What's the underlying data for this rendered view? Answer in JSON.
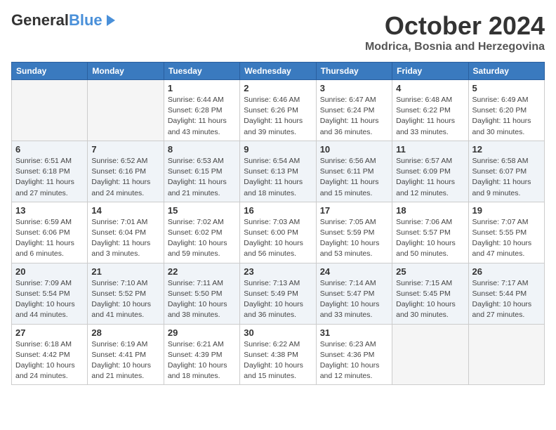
{
  "header": {
    "logo_general": "General",
    "logo_blue": "Blue",
    "month": "October 2024",
    "location": "Modrica, Bosnia and Herzegovina"
  },
  "days_of_week": [
    "Sunday",
    "Monday",
    "Tuesday",
    "Wednesday",
    "Thursday",
    "Friday",
    "Saturday"
  ],
  "weeks": [
    [
      {
        "day": "",
        "sunrise": "",
        "sunset": "",
        "daylight": ""
      },
      {
        "day": "",
        "sunrise": "",
        "sunset": "",
        "daylight": ""
      },
      {
        "day": "1",
        "sunrise": "Sunrise: 6:44 AM",
        "sunset": "Sunset: 6:28 PM",
        "daylight": "Daylight: 11 hours and 43 minutes."
      },
      {
        "day": "2",
        "sunrise": "Sunrise: 6:46 AM",
        "sunset": "Sunset: 6:26 PM",
        "daylight": "Daylight: 11 hours and 39 minutes."
      },
      {
        "day": "3",
        "sunrise": "Sunrise: 6:47 AM",
        "sunset": "Sunset: 6:24 PM",
        "daylight": "Daylight: 11 hours and 36 minutes."
      },
      {
        "day": "4",
        "sunrise": "Sunrise: 6:48 AM",
        "sunset": "Sunset: 6:22 PM",
        "daylight": "Daylight: 11 hours and 33 minutes."
      },
      {
        "day": "5",
        "sunrise": "Sunrise: 6:49 AM",
        "sunset": "Sunset: 6:20 PM",
        "daylight": "Daylight: 11 hours and 30 minutes."
      }
    ],
    [
      {
        "day": "6",
        "sunrise": "Sunrise: 6:51 AM",
        "sunset": "Sunset: 6:18 PM",
        "daylight": "Daylight: 11 hours and 27 minutes."
      },
      {
        "day": "7",
        "sunrise": "Sunrise: 6:52 AM",
        "sunset": "Sunset: 6:16 PM",
        "daylight": "Daylight: 11 hours and 24 minutes."
      },
      {
        "day": "8",
        "sunrise": "Sunrise: 6:53 AM",
        "sunset": "Sunset: 6:15 PM",
        "daylight": "Daylight: 11 hours and 21 minutes."
      },
      {
        "day": "9",
        "sunrise": "Sunrise: 6:54 AM",
        "sunset": "Sunset: 6:13 PM",
        "daylight": "Daylight: 11 hours and 18 minutes."
      },
      {
        "day": "10",
        "sunrise": "Sunrise: 6:56 AM",
        "sunset": "Sunset: 6:11 PM",
        "daylight": "Daylight: 11 hours and 15 minutes."
      },
      {
        "day": "11",
        "sunrise": "Sunrise: 6:57 AM",
        "sunset": "Sunset: 6:09 PM",
        "daylight": "Daylight: 11 hours and 12 minutes."
      },
      {
        "day": "12",
        "sunrise": "Sunrise: 6:58 AM",
        "sunset": "Sunset: 6:07 PM",
        "daylight": "Daylight: 11 hours and 9 minutes."
      }
    ],
    [
      {
        "day": "13",
        "sunrise": "Sunrise: 6:59 AM",
        "sunset": "Sunset: 6:06 PM",
        "daylight": "Daylight: 11 hours and 6 minutes."
      },
      {
        "day": "14",
        "sunrise": "Sunrise: 7:01 AM",
        "sunset": "Sunset: 6:04 PM",
        "daylight": "Daylight: 11 hours and 3 minutes."
      },
      {
        "day": "15",
        "sunrise": "Sunrise: 7:02 AM",
        "sunset": "Sunset: 6:02 PM",
        "daylight": "Daylight: 10 hours and 59 minutes."
      },
      {
        "day": "16",
        "sunrise": "Sunrise: 7:03 AM",
        "sunset": "Sunset: 6:00 PM",
        "daylight": "Daylight: 10 hours and 56 minutes."
      },
      {
        "day": "17",
        "sunrise": "Sunrise: 7:05 AM",
        "sunset": "Sunset: 5:59 PM",
        "daylight": "Daylight: 10 hours and 53 minutes."
      },
      {
        "day": "18",
        "sunrise": "Sunrise: 7:06 AM",
        "sunset": "Sunset: 5:57 PM",
        "daylight": "Daylight: 10 hours and 50 minutes."
      },
      {
        "day": "19",
        "sunrise": "Sunrise: 7:07 AM",
        "sunset": "Sunset: 5:55 PM",
        "daylight": "Daylight: 10 hours and 47 minutes."
      }
    ],
    [
      {
        "day": "20",
        "sunrise": "Sunrise: 7:09 AM",
        "sunset": "Sunset: 5:54 PM",
        "daylight": "Daylight: 10 hours and 44 minutes."
      },
      {
        "day": "21",
        "sunrise": "Sunrise: 7:10 AM",
        "sunset": "Sunset: 5:52 PM",
        "daylight": "Daylight: 10 hours and 41 minutes."
      },
      {
        "day": "22",
        "sunrise": "Sunrise: 7:11 AM",
        "sunset": "Sunset: 5:50 PM",
        "daylight": "Daylight: 10 hours and 38 minutes."
      },
      {
        "day": "23",
        "sunrise": "Sunrise: 7:13 AM",
        "sunset": "Sunset: 5:49 PM",
        "daylight": "Daylight: 10 hours and 36 minutes."
      },
      {
        "day": "24",
        "sunrise": "Sunrise: 7:14 AM",
        "sunset": "Sunset: 5:47 PM",
        "daylight": "Daylight: 10 hours and 33 minutes."
      },
      {
        "day": "25",
        "sunrise": "Sunrise: 7:15 AM",
        "sunset": "Sunset: 5:45 PM",
        "daylight": "Daylight: 10 hours and 30 minutes."
      },
      {
        "day": "26",
        "sunrise": "Sunrise: 7:17 AM",
        "sunset": "Sunset: 5:44 PM",
        "daylight": "Daylight: 10 hours and 27 minutes."
      }
    ],
    [
      {
        "day": "27",
        "sunrise": "Sunrise: 6:18 AM",
        "sunset": "Sunset: 4:42 PM",
        "daylight": "Daylight: 10 hours and 24 minutes."
      },
      {
        "day": "28",
        "sunrise": "Sunrise: 6:19 AM",
        "sunset": "Sunset: 4:41 PM",
        "daylight": "Daylight: 10 hours and 21 minutes."
      },
      {
        "day": "29",
        "sunrise": "Sunrise: 6:21 AM",
        "sunset": "Sunset: 4:39 PM",
        "daylight": "Daylight: 10 hours and 18 minutes."
      },
      {
        "day": "30",
        "sunrise": "Sunrise: 6:22 AM",
        "sunset": "Sunset: 4:38 PM",
        "daylight": "Daylight: 10 hours and 15 minutes."
      },
      {
        "day": "31",
        "sunrise": "Sunrise: 6:23 AM",
        "sunset": "Sunset: 4:36 PM",
        "daylight": "Daylight: 10 hours and 12 minutes."
      },
      {
        "day": "",
        "sunrise": "",
        "sunset": "",
        "daylight": ""
      },
      {
        "day": "",
        "sunrise": "",
        "sunset": "",
        "daylight": ""
      }
    ]
  ]
}
